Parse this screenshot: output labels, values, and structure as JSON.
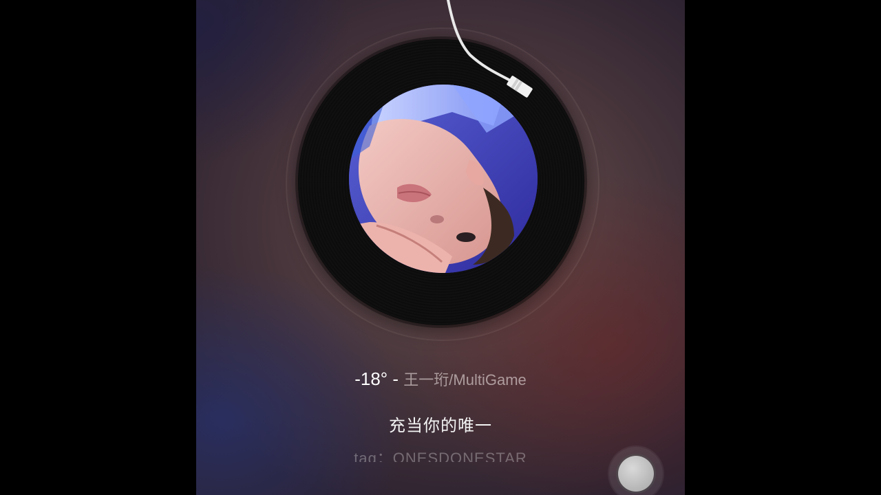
{
  "player": {
    "song_title": "-18°",
    "separator": " - ",
    "artist_album": "王一珩/MultiGame",
    "lyric_line": "充当你的唯一",
    "tag_line": "tag：ONESDONESTAR"
  },
  "icons": {
    "tonearm": "tonearm-icon",
    "floating_button": "assistive-touch-button"
  },
  "colors": {
    "background_mid": "#6b5350",
    "record_black": "#0b0b0b",
    "text_primary": "#ffffff",
    "text_muted": "#b8aaaa"
  }
}
